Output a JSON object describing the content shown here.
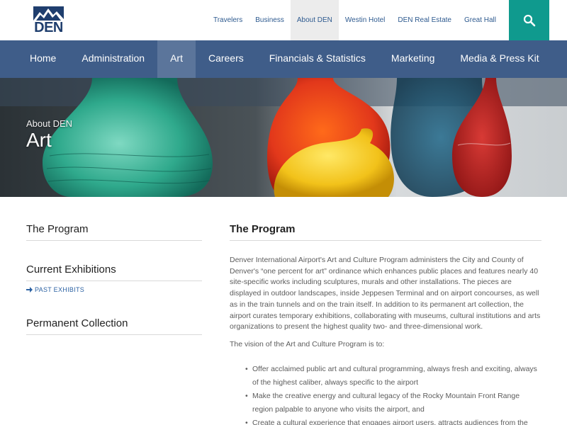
{
  "header": {
    "logo_text": "DEN",
    "utility_links": [
      {
        "label": "Travelers"
      },
      {
        "label": "Business"
      },
      {
        "label": "About DEN",
        "active": true
      },
      {
        "label": "Westin Hotel"
      },
      {
        "label": "DEN Real Estate"
      },
      {
        "label": "Great Hall"
      }
    ],
    "search_icon": "search-icon"
  },
  "main_nav": {
    "items": [
      {
        "label": "Home"
      },
      {
        "label": "Administration"
      },
      {
        "label": "Art",
        "active": true
      },
      {
        "label": "Careers"
      },
      {
        "label": "Financials & Statistics"
      },
      {
        "label": "Marketing"
      },
      {
        "label": "Media & Press Kit"
      }
    ]
  },
  "hero": {
    "eyebrow": "About DEN",
    "title": "Art"
  },
  "sidebar": {
    "sections": [
      {
        "heading": "The Program"
      },
      {
        "heading": "Current Exhibitions",
        "sub_link": "PAST EXHIBITS"
      },
      {
        "heading": "Permanent Collection"
      }
    ]
  },
  "main": {
    "heading": "The Program",
    "paragraphs": [
      "Denver International Airport's Art and Culture Program administers the City and County of Denver's “one percent for art” ordinance which enhances public places and features nearly 40 site-specific works including sculptures, murals and other installations. The pieces are displayed in outdoor landscapes, inside Jeppesen Terminal and on airport concourses, as well as in the train tunnels and on the train itself. In addition to its permanent art collection, the airport curates temporary exhibitions, collaborating with museums, cultural institutions and arts organizations to present the highest quality two- and three-dimensional work.",
      "The vision of the Art and Culture Program is to:"
    ],
    "bullets": [
      "Offer acclaimed public art and cultural programming, always fresh and exciting, always of the highest caliber, always specific to the airport",
      "Make the creative energy and cultural legacy of the Rocky Mountain Front Range region palpable to anyone who visits the airport, and",
      "Create a cultural experience that engages airport users, attracts audiences from the"
    ]
  },
  "colors": {
    "brand_navy": "#1f3e6e",
    "nav_blue": "#3f5d89",
    "nav_active": "#5b759b",
    "search_teal": "#0f9a8e",
    "link_blue": "#2c62a3"
  }
}
